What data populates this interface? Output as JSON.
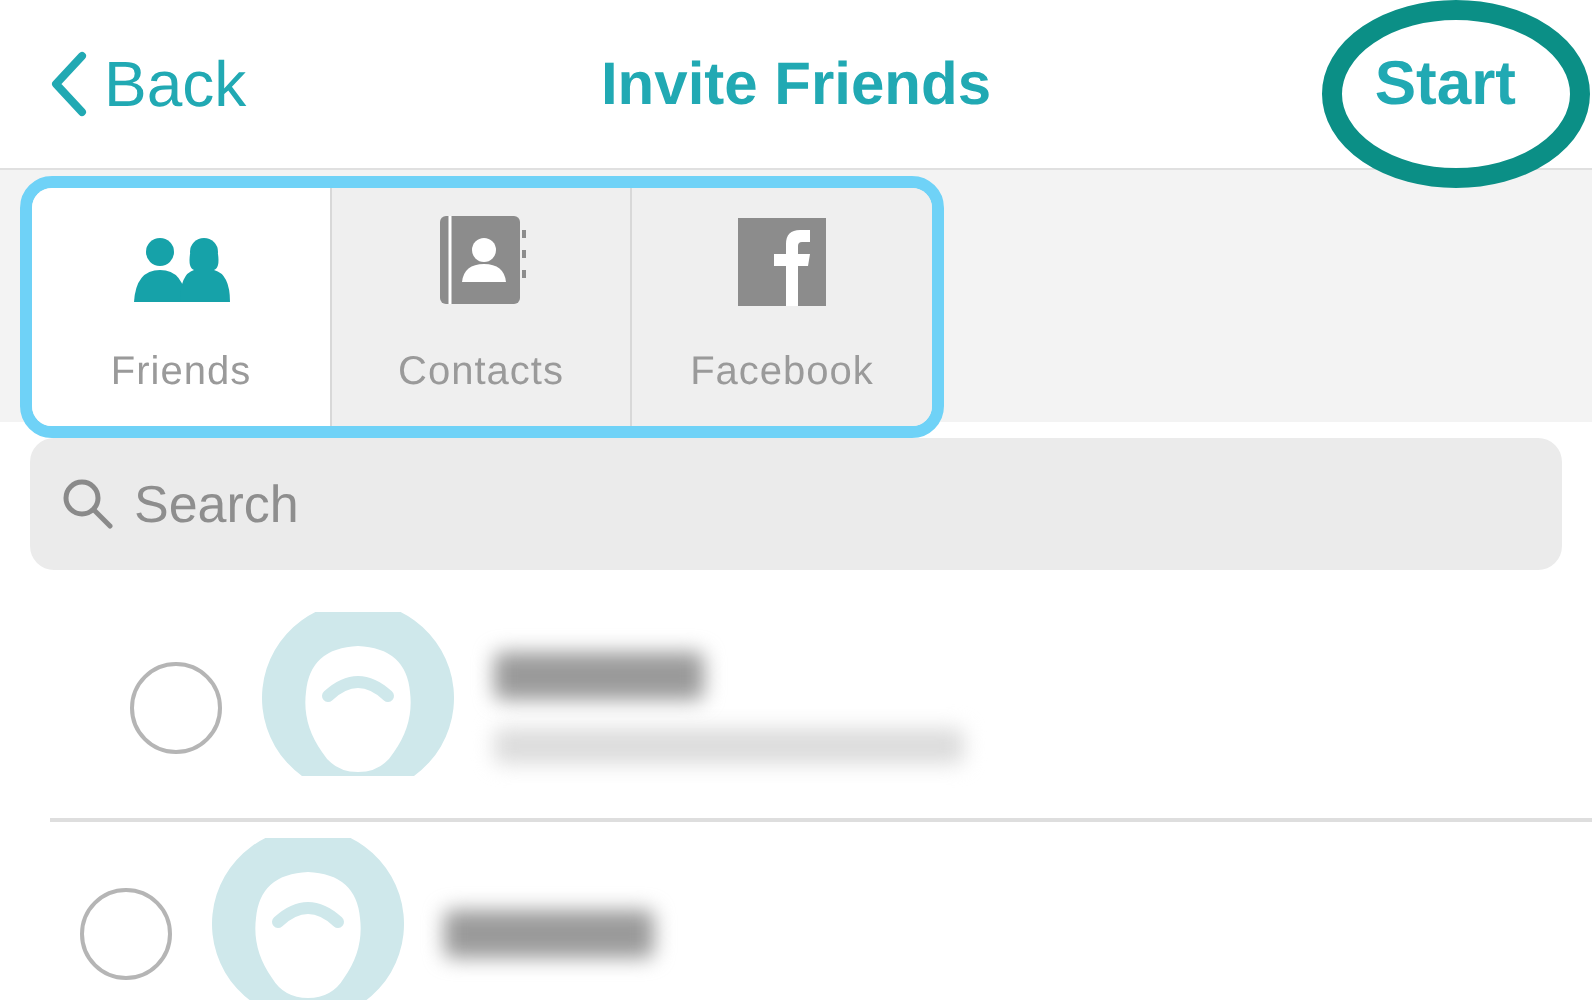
{
  "nav": {
    "back": "Back",
    "title": "Invite Friends",
    "action": "Start"
  },
  "tabs": [
    {
      "label": "Friends",
      "kind": "friends",
      "selected": true
    },
    {
      "label": "Contacts",
      "kind": "contacts",
      "selected": false
    },
    {
      "label": "Facebook",
      "kind": "facebook",
      "selected": false
    }
  ],
  "search": {
    "placeholder": "Search"
  },
  "friends": [
    {
      "checked": false
    },
    {
      "checked": false
    }
  ]
}
